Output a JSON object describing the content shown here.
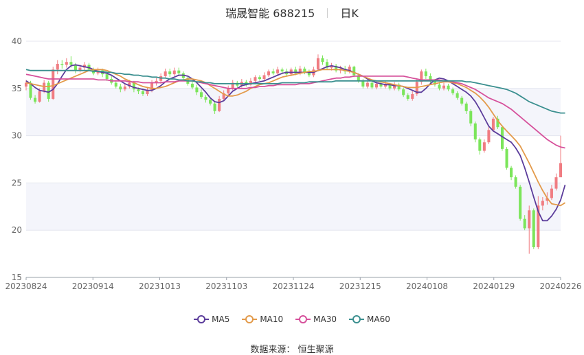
{
  "header": {
    "title": "瑞晟智能 688215",
    "period": "日K"
  },
  "source": {
    "label": "数据来源：",
    "name": "恒生聚源"
  },
  "colors": {
    "up": "#f07c82",
    "down": "#7be55a",
    "ma5": "#5b3c9b",
    "ma10": "#e39a4a",
    "ma30": "#d6509b",
    "ma60": "#3a8f8f",
    "axis": "#666666",
    "grid": "#e4e6ef",
    "band": "#f4f5fb"
  },
  "chart_data": {
    "type": "candlestick",
    "title": "瑞晟智能 688215",
    "ylim": [
      15,
      40
    ],
    "y_ticks": [
      15,
      20,
      25,
      30,
      35,
      40
    ],
    "x_ticks": [
      "20230824",
      "20230914",
      "20231013",
      "20231103",
      "20231124",
      "20231215",
      "20240108",
      "20240129",
      "20240226"
    ],
    "legend": [
      "MA5",
      "MA10",
      "MA30",
      "MA60"
    ],
    "candles": [
      [
        35.2,
        35.6,
        34.8,
        35.9
      ],
      [
        35.6,
        34.0,
        33.8,
        35.8
      ],
      [
        34.0,
        33.6,
        33.4,
        34.3
      ],
      [
        33.6,
        34.7,
        33.5,
        35.0
      ],
      [
        34.7,
        35.6,
        34.5,
        35.9
      ],
      [
        35.6,
        33.9,
        33.6,
        35.8
      ],
      [
        33.9,
        37.0,
        33.8,
        37.3
      ],
      [
        37.0,
        37.6,
        36.5,
        38.0
      ],
      [
        37.6,
        37.5,
        37.1,
        38.0
      ],
      [
        37.5,
        37.8,
        37.2,
        38.2
      ],
      [
        37.8,
        37.5,
        37.2,
        38.4
      ],
      [
        37.5,
        36.9,
        36.6,
        37.7
      ],
      [
        36.9,
        37.2,
        36.7,
        37.5
      ],
      [
        37.2,
        37.5,
        36.9,
        37.8
      ],
      [
        37.5,
        37.0,
        36.8,
        37.7
      ],
      [
        37.0,
        36.6,
        36.4,
        37.2
      ],
      [
        36.6,
        36.9,
        36.4,
        37.2
      ],
      [
        36.9,
        36.5,
        36.2,
        37.1
      ],
      [
        36.5,
        36.0,
        35.8,
        36.8
      ],
      [
        36.0,
        35.6,
        35.4,
        36.3
      ],
      [
        35.6,
        35.2,
        35.0,
        35.9
      ],
      [
        35.2,
        34.9,
        34.6,
        35.5
      ],
      [
        34.9,
        35.2,
        34.7,
        35.5
      ],
      [
        35.2,
        35.6,
        35.0,
        35.9
      ],
      [
        35.6,
        34.9,
        34.6,
        35.8
      ],
      [
        34.9,
        34.7,
        34.4,
        35.1
      ],
      [
        34.7,
        34.4,
        34.2,
        35.0
      ],
      [
        34.4,
        34.8,
        34.2,
        35.1
      ],
      [
        34.8,
        35.6,
        34.6,
        35.9
      ],
      [
        35.6,
        35.8,
        35.3,
        36.1
      ],
      [
        35.8,
        36.3,
        35.5,
        36.6
      ],
      [
        36.3,
        36.8,
        36.1,
        37.1
      ],
      [
        36.8,
        36.5,
        36.2,
        37.1
      ],
      [
        36.5,
        36.9,
        36.3,
        37.2
      ],
      [
        36.9,
        36.6,
        36.3,
        37.2
      ],
      [
        36.6,
        36.1,
        35.9,
        36.8
      ],
      [
        36.1,
        35.5,
        35.3,
        36.3
      ],
      [
        35.5,
        35.1,
        34.9,
        35.8
      ],
      [
        35.1,
        34.6,
        34.3,
        35.4
      ],
      [
        34.6,
        34.1,
        33.9,
        34.9
      ],
      [
        34.1,
        33.8,
        33.5,
        34.3
      ],
      [
        33.8,
        33.4,
        33.2,
        34.0
      ],
      [
        33.4,
        32.6,
        32.3,
        33.6
      ],
      [
        32.6,
        33.9,
        32.5,
        34.2
      ],
      [
        33.9,
        34.5,
        33.7,
        34.8
      ],
      [
        34.5,
        35.0,
        34.3,
        35.3
      ],
      [
        35.0,
        35.6,
        34.8,
        35.9
      ],
      [
        35.6,
        35.3,
        35.1,
        35.8
      ],
      [
        35.3,
        35.7,
        35.1,
        36.0
      ],
      [
        35.7,
        35.4,
        35.2,
        35.9
      ],
      [
        35.4,
        35.8,
        35.3,
        36.1
      ],
      [
        35.8,
        36.2,
        35.6,
        36.4
      ],
      [
        36.2,
        36.0,
        35.8,
        36.4
      ],
      [
        36.0,
        36.4,
        35.8,
        36.7
      ],
      [
        36.4,
        36.8,
        36.2,
        37.0
      ],
      [
        36.8,
        36.6,
        36.4,
        37.1
      ],
      [
        36.6,
        37.0,
        36.4,
        37.3
      ],
      [
        37.0,
        36.8,
        36.5,
        37.2
      ],
      [
        36.8,
        36.5,
        36.3,
        37.1
      ],
      [
        36.5,
        37.0,
        36.3,
        37.2
      ],
      [
        37.0,
        36.6,
        36.4,
        37.3
      ],
      [
        36.6,
        37.1,
        36.4,
        37.4
      ],
      [
        37.1,
        36.7,
        36.5,
        37.3
      ],
      [
        36.7,
        36.4,
        36.2,
        37.0
      ],
      [
        36.4,
        37.0,
        36.2,
        37.3
      ],
      [
        37.0,
        38.2,
        36.8,
        38.6
      ],
      [
        38.2,
        37.8,
        37.5,
        38.5
      ],
      [
        37.8,
        37.2,
        37.0,
        38.1
      ],
      [
        37.2,
        37.4,
        36.9,
        37.7
      ],
      [
        37.4,
        36.9,
        36.7,
        37.6
      ],
      [
        36.9,
        37.1,
        36.6,
        37.4
      ],
      [
        37.1,
        36.8,
        36.5,
        37.4
      ],
      [
        36.8,
        37.3,
        36.6,
        37.5
      ],
      [
        37.3,
        36.4,
        36.2,
        37.4
      ],
      [
        36.4,
        35.8,
        35.6,
        36.6
      ],
      [
        35.8,
        35.2,
        35.0,
        36.0
      ],
      [
        35.2,
        35.6,
        35.0,
        35.9
      ],
      [
        35.6,
        35.1,
        34.9,
        35.8
      ],
      [
        35.1,
        35.5,
        34.9,
        35.8
      ],
      [
        35.5,
        35.2,
        35.0,
        35.7
      ],
      [
        35.2,
        35.5,
        35.0,
        35.8
      ],
      [
        35.5,
        35.0,
        34.8,
        35.6
      ],
      [
        35.0,
        35.4,
        34.8,
        35.7
      ],
      [
        35.4,
        34.9,
        34.7,
        35.6
      ],
      [
        34.9,
        34.3,
        34.1,
        35.1
      ],
      [
        34.3,
        33.9,
        33.7,
        34.5
      ],
      [
        33.9,
        34.4,
        33.7,
        34.7
      ],
      [
        34.4,
        35.7,
        34.2,
        36.0
      ],
      [
        35.7,
        36.8,
        35.4,
        37.0
      ],
      [
        36.8,
        36.3,
        36.0,
        37.1
      ],
      [
        36.3,
        35.8,
        35.5,
        36.6
      ],
      [
        35.8,
        35.4,
        35.2,
        36.0
      ],
      [
        35.4,
        35.0,
        34.8,
        35.7
      ],
      [
        35.0,
        35.3,
        34.8,
        35.6
      ],
      [
        35.3,
        34.9,
        34.7,
        35.5
      ],
      [
        34.9,
        34.5,
        34.3,
        35.1
      ],
      [
        34.5,
        34.0,
        33.8,
        34.7
      ],
      [
        34.0,
        33.4,
        33.2,
        34.2
      ],
      [
        33.4,
        32.6,
        32.3,
        33.6
      ],
      [
        32.6,
        31.3,
        31.0,
        32.8
      ],
      [
        31.3,
        29.6,
        29.3,
        31.5
      ],
      [
        29.6,
        28.4,
        28.0,
        29.8
      ],
      [
        28.4,
        29.3,
        28.2,
        29.6
      ],
      [
        29.3,
        30.6,
        29.1,
        30.9
      ],
      [
        30.6,
        31.8,
        30.4,
        32.0
      ],
      [
        31.8,
        30.9,
        30.7,
        32.1
      ],
      [
        30.9,
        28.6,
        28.4,
        31.1
      ],
      [
        28.6,
        26.6,
        26.4,
        28.8
      ],
      [
        26.6,
        25.6,
        25.3,
        26.8
      ],
      [
        25.6,
        24.6,
        24.4,
        25.8
      ],
      [
        24.6,
        21.2,
        21.0,
        24.8
      ],
      [
        21.2,
        20.2,
        20.0,
        21.6
      ],
      [
        20.2,
        22.1,
        17.5,
        22.6
      ],
      [
        22.1,
        18.2,
        18.0,
        22.3
      ],
      [
        18.2,
        22.6,
        18.0,
        23.6
      ],
      [
        22.6,
        23.1,
        22.1,
        23.5
      ],
      [
        23.1,
        23.4,
        22.7,
        24.0
      ],
      [
        23.4,
        24.4,
        23.2,
        24.8
      ],
      [
        24.4,
        25.6,
        24.2,
        26.0
      ],
      [
        25.6,
        27.1,
        26.9,
        30.0
      ]
    ],
    "series": [
      {
        "name": "MA5",
        "values": [
          35.8,
          35.5,
          35.1,
          34.8,
          34.7,
          34.6,
          34.9,
          35.5,
          36.3,
          37.0,
          37.4,
          37.5,
          37.4,
          37.3,
          37.2,
          37.0,
          36.8,
          36.7,
          36.6,
          36.4,
          36.1,
          35.8,
          35.5,
          35.3,
          35.1,
          35.0,
          34.9,
          34.8,
          34.8,
          35.0,
          35.3,
          35.7,
          36.0,
          36.2,
          36.4,
          36.4,
          36.3,
          36.0,
          35.6,
          35.1,
          34.6,
          34.0,
          33.6,
          33.5,
          33.7,
          34.2,
          34.7,
          35.0,
          35.3,
          35.4,
          35.5,
          35.6,
          35.7,
          35.8,
          36.0,
          36.2,
          36.4,
          36.6,
          36.7,
          36.7,
          36.7,
          36.7,
          36.7,
          36.7,
          36.7,
          36.9,
          37.1,
          37.3,
          37.4,
          37.3,
          37.2,
          37.0,
          36.9,
          36.7,
          36.5,
          36.3,
          36.0,
          35.8,
          35.6,
          35.5,
          35.4,
          35.4,
          35.3,
          35.3,
          35.2,
          35.0,
          34.8,
          34.6,
          34.6,
          35.0,
          35.5,
          35.9,
          36.1,
          36.0,
          35.8,
          35.5,
          35.2,
          34.9,
          34.6,
          34.2,
          33.6,
          32.8,
          31.9,
          31.0,
          30.5,
          30.2,
          29.9,
          29.6,
          29.3,
          28.7,
          27.9,
          26.6,
          25.1,
          23.5,
          22.0,
          21.0,
          21.0,
          21.5,
          22.2,
          23.2,
          24.8
        ]
      },
      {
        "name": "MA10",
        "values": [
          35.6,
          35.5,
          35.4,
          35.3,
          35.2,
          35.2,
          35.3,
          35.5,
          35.7,
          35.9,
          36.1,
          36.3,
          36.5,
          36.7,
          36.9,
          37.0,
          37.0,
          37.0,
          36.9,
          36.7,
          36.5,
          36.3,
          36.0,
          35.8,
          35.6,
          35.4,
          35.2,
          35.1,
          35.0,
          35.0,
          35.1,
          35.2,
          35.4,
          35.6,
          35.8,
          35.9,
          36.0,
          36.0,
          35.9,
          35.8,
          35.6,
          35.3,
          35.0,
          34.7,
          34.4,
          34.2,
          34.2,
          34.3,
          34.5,
          34.7,
          35.0,
          35.2,
          35.4,
          35.5,
          35.6,
          35.8,
          36.0,
          36.2,
          36.3,
          36.4,
          36.5,
          36.6,
          36.7,
          36.8,
          36.8,
          36.9,
          37.0,
          37.0,
          37.0,
          37.0,
          37.0,
          36.9,
          36.8,
          36.7,
          36.5,
          36.3,
          36.1,
          35.9,
          35.8,
          35.7,
          35.6,
          35.5,
          35.4,
          35.3,
          35.2,
          35.1,
          35.1,
          35.1,
          35.2,
          35.3,
          35.4,
          35.5,
          35.6,
          35.7,
          35.7,
          35.6,
          35.5,
          35.3,
          35.1,
          34.8,
          34.5,
          34.1,
          33.6,
          33.0,
          32.3,
          31.6,
          31.0,
          30.5,
          30.0,
          29.5,
          28.9,
          28.0,
          27.1,
          26.1,
          25.1,
          24.2,
          23.4,
          22.8,
          22.7,
          22.6,
          22.9
        ]
      },
      {
        "name": "MA30",
        "values": [
          36.5,
          36.4,
          36.3,
          36.2,
          36.1,
          36.0,
          36.0,
          36.0,
          36.0,
          36.0,
          36.0,
          36.0,
          36.0,
          36.0,
          36.0,
          36.0,
          35.9,
          35.9,
          35.9,
          35.8,
          35.8,
          35.8,
          35.8,
          35.7,
          35.7,
          35.7,
          35.6,
          35.6,
          35.6,
          35.6,
          35.6,
          35.7,
          35.7,
          35.7,
          35.8,
          35.8,
          35.8,
          35.8,
          35.7,
          35.6,
          35.5,
          35.4,
          35.3,
          35.2,
          35.1,
          35.0,
          35.0,
          35.0,
          35.0,
          35.0,
          35.1,
          35.1,
          35.2,
          35.2,
          35.3,
          35.3,
          35.4,
          35.4,
          35.4,
          35.4,
          35.4,
          35.5,
          35.5,
          35.5,
          35.6,
          35.7,
          35.8,
          35.9,
          36.0,
          36.1,
          36.1,
          36.2,
          36.2,
          36.3,
          36.3,
          36.3,
          36.3,
          36.3,
          36.3,
          36.3,
          36.3,
          36.3,
          36.3,
          36.3,
          36.3,
          36.2,
          36.1,
          36.0,
          35.9,
          35.9,
          35.9,
          35.9,
          35.9,
          35.8,
          35.8,
          35.7,
          35.6,
          35.5,
          35.3,
          35.1,
          34.9,
          34.6,
          34.3,
          34.0,
          33.8,
          33.6,
          33.4,
          33.1,
          32.8,
          32.4,
          32.0,
          31.6,
          31.2,
          30.8,
          30.4,
          30.0,
          29.6,
          29.3,
          29.0,
          28.8,
          28.7
        ]
      },
      {
        "name": "MA60",
        "values": [
          37.0,
          36.9,
          36.9,
          36.9,
          36.9,
          36.9,
          36.9,
          36.9,
          36.9,
          36.9,
          36.9,
          36.9,
          36.9,
          36.9,
          36.9,
          36.8,
          36.8,
          36.8,
          36.7,
          36.7,
          36.6,
          36.6,
          36.5,
          36.5,
          36.4,
          36.4,
          36.3,
          36.3,
          36.2,
          36.2,
          36.1,
          36.1,
          36.0,
          36.0,
          35.9,
          35.9,
          35.8,
          35.8,
          35.7,
          35.7,
          35.6,
          35.6,
          35.5,
          35.5,
          35.5,
          35.5,
          35.5,
          35.5,
          35.5,
          35.5,
          35.5,
          35.5,
          35.5,
          35.5,
          35.5,
          35.5,
          35.5,
          35.6,
          35.6,
          35.6,
          35.6,
          35.6,
          35.6,
          35.7,
          35.7,
          35.7,
          35.7,
          35.7,
          35.7,
          35.8,
          35.8,
          35.8,
          35.8,
          35.8,
          35.8,
          35.8,
          35.8,
          35.8,
          35.8,
          35.8,
          35.8,
          35.8,
          35.8,
          35.8,
          35.8,
          35.8,
          35.8,
          35.8,
          35.8,
          35.8,
          35.8,
          35.8,
          35.8,
          35.8,
          35.8,
          35.8,
          35.8,
          35.8,
          35.7,
          35.7,
          35.6,
          35.5,
          35.4,
          35.3,
          35.2,
          35.1,
          35.0,
          34.9,
          34.7,
          34.5,
          34.2,
          33.9,
          33.6,
          33.4,
          33.2,
          33.0,
          32.8,
          32.6,
          32.5,
          32.4,
          32.4
        ]
      }
    ]
  }
}
